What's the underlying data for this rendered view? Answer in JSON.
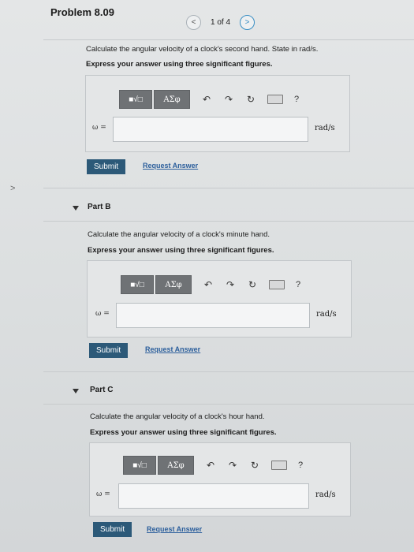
{
  "header": {
    "title": "Problem 8.09",
    "pager": {
      "prev_glyph": "<",
      "text": "1 of 4",
      "next_glyph": ">"
    }
  },
  "nav": {
    "left_arrow_glyph": ">"
  },
  "toolbar": {
    "format_glyph": "■√□",
    "greek_label": "ΑΣφ",
    "undo_glyph": "↶",
    "redo_glyph": "↷",
    "reset_glyph": "↻",
    "help_glyph": "?"
  },
  "answer": {
    "var_label": "ω =",
    "unit": "rad/s",
    "submit_label": "Submit",
    "request_label": "Request Answer"
  },
  "part_a": {
    "question": "Calculate the angular velocity of a clock's second hand. State in rad/s.",
    "instruction": "Express your answer using three significant figures."
  },
  "part_b": {
    "label": "Part B",
    "question": "Calculate the angular velocity of a clock's minute hand.",
    "instruction": "Express your answer using three significant figures."
  },
  "part_c": {
    "label": "Part C",
    "question": "Calculate the angular velocity of a clock's hour hand.",
    "instruction": "Express your answer using three significant figures."
  },
  "colors": {
    "submit_bg": "#2c5978",
    "link": "#2c5f9c",
    "toolbar_btn": "#6f7275"
  }
}
